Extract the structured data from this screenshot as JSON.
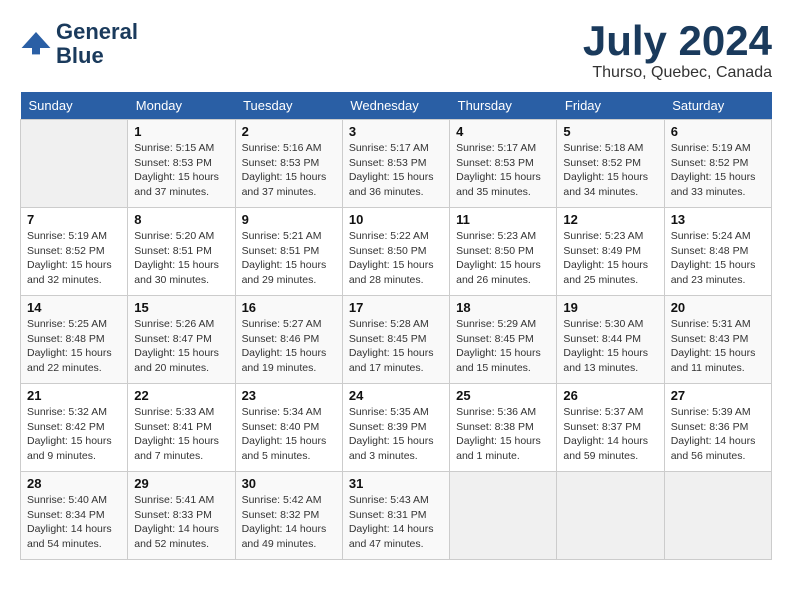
{
  "header": {
    "logo_line1": "General",
    "logo_line2": "Blue",
    "month": "July 2024",
    "location": "Thurso, Quebec, Canada"
  },
  "calendar": {
    "days_of_week": [
      "Sunday",
      "Monday",
      "Tuesday",
      "Wednesday",
      "Thursday",
      "Friday",
      "Saturday"
    ],
    "weeks": [
      [
        {
          "day": "",
          "info": ""
        },
        {
          "day": "1",
          "info": "Sunrise: 5:15 AM\nSunset: 8:53 PM\nDaylight: 15 hours and 37 minutes."
        },
        {
          "day": "2",
          "info": "Sunrise: 5:16 AM\nSunset: 8:53 PM\nDaylight: 15 hours and 37 minutes."
        },
        {
          "day": "3",
          "info": "Sunrise: 5:17 AM\nSunset: 8:53 PM\nDaylight: 15 hours and 36 minutes."
        },
        {
          "day": "4",
          "info": "Sunrise: 5:17 AM\nSunset: 8:53 PM\nDaylight: 15 hours and 35 minutes."
        },
        {
          "day": "5",
          "info": "Sunrise: 5:18 AM\nSunset: 8:52 PM\nDaylight: 15 hours and 34 minutes."
        },
        {
          "day": "6",
          "info": "Sunrise: 5:19 AM\nSunset: 8:52 PM\nDaylight: 15 hours and 33 minutes."
        }
      ],
      [
        {
          "day": "7",
          "info": "Sunrise: 5:19 AM\nSunset: 8:52 PM\nDaylight: 15 hours and 32 minutes."
        },
        {
          "day": "8",
          "info": "Sunrise: 5:20 AM\nSunset: 8:51 PM\nDaylight: 15 hours and 30 minutes."
        },
        {
          "day": "9",
          "info": "Sunrise: 5:21 AM\nSunset: 8:51 PM\nDaylight: 15 hours and 29 minutes."
        },
        {
          "day": "10",
          "info": "Sunrise: 5:22 AM\nSunset: 8:50 PM\nDaylight: 15 hours and 28 minutes."
        },
        {
          "day": "11",
          "info": "Sunrise: 5:23 AM\nSunset: 8:50 PM\nDaylight: 15 hours and 26 minutes."
        },
        {
          "day": "12",
          "info": "Sunrise: 5:23 AM\nSunset: 8:49 PM\nDaylight: 15 hours and 25 minutes."
        },
        {
          "day": "13",
          "info": "Sunrise: 5:24 AM\nSunset: 8:48 PM\nDaylight: 15 hours and 23 minutes."
        }
      ],
      [
        {
          "day": "14",
          "info": "Sunrise: 5:25 AM\nSunset: 8:48 PM\nDaylight: 15 hours and 22 minutes."
        },
        {
          "day": "15",
          "info": "Sunrise: 5:26 AM\nSunset: 8:47 PM\nDaylight: 15 hours and 20 minutes."
        },
        {
          "day": "16",
          "info": "Sunrise: 5:27 AM\nSunset: 8:46 PM\nDaylight: 15 hours and 19 minutes."
        },
        {
          "day": "17",
          "info": "Sunrise: 5:28 AM\nSunset: 8:45 PM\nDaylight: 15 hours and 17 minutes."
        },
        {
          "day": "18",
          "info": "Sunrise: 5:29 AM\nSunset: 8:45 PM\nDaylight: 15 hours and 15 minutes."
        },
        {
          "day": "19",
          "info": "Sunrise: 5:30 AM\nSunset: 8:44 PM\nDaylight: 15 hours and 13 minutes."
        },
        {
          "day": "20",
          "info": "Sunrise: 5:31 AM\nSunset: 8:43 PM\nDaylight: 15 hours and 11 minutes."
        }
      ],
      [
        {
          "day": "21",
          "info": "Sunrise: 5:32 AM\nSunset: 8:42 PM\nDaylight: 15 hours and 9 minutes."
        },
        {
          "day": "22",
          "info": "Sunrise: 5:33 AM\nSunset: 8:41 PM\nDaylight: 15 hours and 7 minutes."
        },
        {
          "day": "23",
          "info": "Sunrise: 5:34 AM\nSunset: 8:40 PM\nDaylight: 15 hours and 5 minutes."
        },
        {
          "day": "24",
          "info": "Sunrise: 5:35 AM\nSunset: 8:39 PM\nDaylight: 15 hours and 3 minutes."
        },
        {
          "day": "25",
          "info": "Sunrise: 5:36 AM\nSunset: 8:38 PM\nDaylight: 15 hours and 1 minute."
        },
        {
          "day": "26",
          "info": "Sunrise: 5:37 AM\nSunset: 8:37 PM\nDaylight: 14 hours and 59 minutes."
        },
        {
          "day": "27",
          "info": "Sunrise: 5:39 AM\nSunset: 8:36 PM\nDaylight: 14 hours and 56 minutes."
        }
      ],
      [
        {
          "day": "28",
          "info": "Sunrise: 5:40 AM\nSunset: 8:34 PM\nDaylight: 14 hours and 54 minutes."
        },
        {
          "day": "29",
          "info": "Sunrise: 5:41 AM\nSunset: 8:33 PM\nDaylight: 14 hours and 52 minutes."
        },
        {
          "day": "30",
          "info": "Sunrise: 5:42 AM\nSunset: 8:32 PM\nDaylight: 14 hours and 49 minutes."
        },
        {
          "day": "31",
          "info": "Sunrise: 5:43 AM\nSunset: 8:31 PM\nDaylight: 14 hours and 47 minutes."
        },
        {
          "day": "",
          "info": ""
        },
        {
          "day": "",
          "info": ""
        },
        {
          "day": "",
          "info": ""
        }
      ]
    ]
  }
}
